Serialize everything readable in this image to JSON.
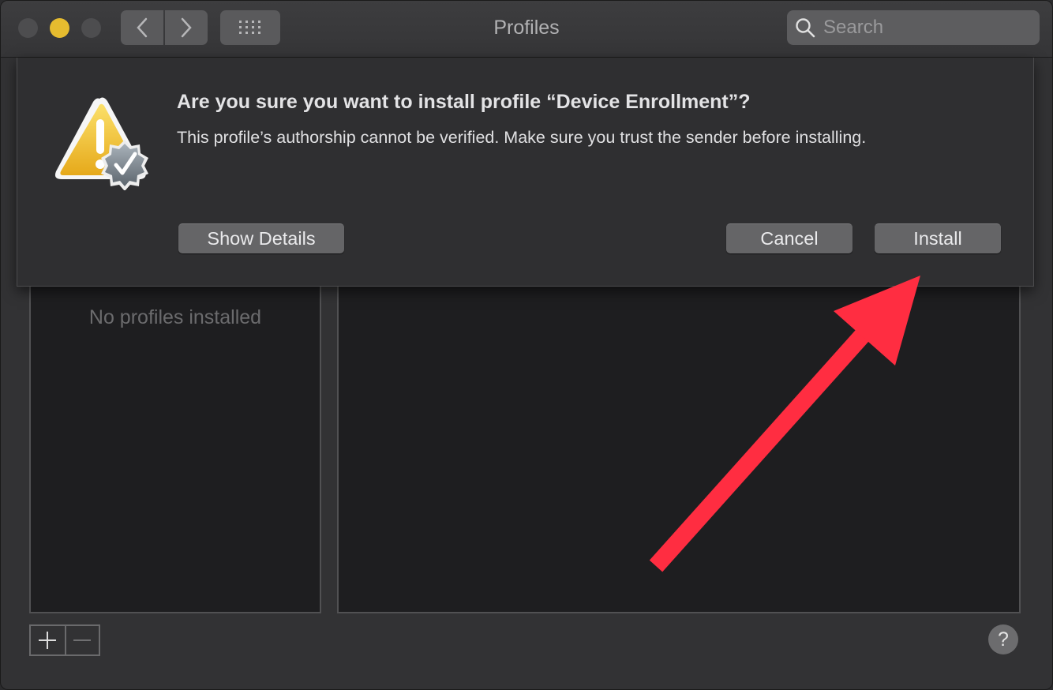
{
  "window": {
    "title": "Profiles"
  },
  "toolbar": {
    "back_icon": "chevron-left-icon",
    "forward_icon": "chevron-right-icon",
    "grid_icon": "grid-icon",
    "search": {
      "placeholder": "Search",
      "value": ""
    }
  },
  "dialog": {
    "icon": "warning-verified-icon",
    "title": "Are you sure you want to install profile “Device Enrollment”?",
    "message": "This profile’s authorship cannot be verified. Make sure you trust the sender before installing.",
    "show_details_label": "Show Details",
    "cancel_label": "Cancel",
    "install_label": "Install"
  },
  "profiles": {
    "empty_text": "No profiles installed",
    "items": []
  },
  "footer": {
    "add_icon": "plus-icon",
    "remove_icon": "minus-icon",
    "help_label": "?"
  },
  "annotation": {
    "arrow_color": "#ff2d41",
    "points_to": "install-button"
  },
  "colors": {
    "minimize_light": "#e6bc2f",
    "warning_yellow": "#f2c230"
  }
}
